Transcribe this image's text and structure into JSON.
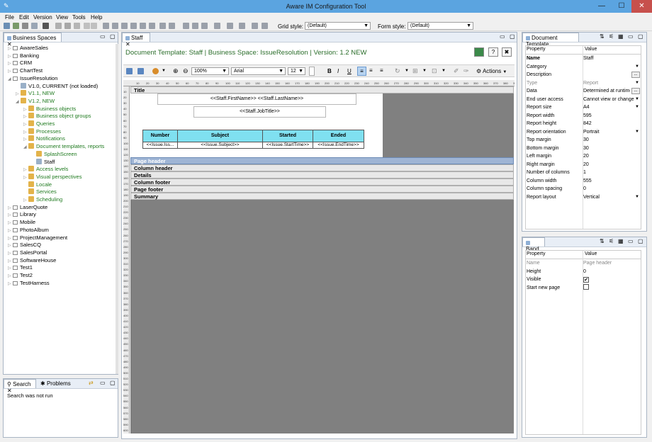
{
  "window": {
    "title": "Aware IM Configuration Tool",
    "min": "—",
    "max": "☐",
    "close": "✕"
  },
  "menu": [
    "File",
    "Edit",
    "Version",
    "View",
    "Tools",
    "Help"
  ],
  "toolbar": {
    "grid_style_label": "Grid style:",
    "grid_style_value": "(Default)",
    "form_style_label": "Form style:",
    "form_style_value": "(Default)"
  },
  "left_panel": {
    "tab": "Business Spaces",
    "tree": [
      {
        "label": "AwareSales",
        "indent": 0,
        "expand": "▷",
        "green": false
      },
      {
        "label": "Banking",
        "indent": 0,
        "expand": "▷",
        "green": false
      },
      {
        "label": "CRM",
        "indent": 0,
        "expand": "▷",
        "green": false
      },
      {
        "label": "ChartTest",
        "indent": 0,
        "expand": "▷",
        "green": false
      },
      {
        "label": "IssueResolution",
        "indent": 0,
        "expand": "◢",
        "green": false
      },
      {
        "label": "V1.0, CURRENT (not loaded)",
        "indent": 1,
        "expand": "",
        "green": false
      },
      {
        "label": "V1.1, NEW",
        "indent": 1,
        "expand": "▷",
        "green": true
      },
      {
        "label": "V1.2, NEW",
        "indent": 1,
        "expand": "◢",
        "green": true
      },
      {
        "label": "Business objects",
        "indent": 2,
        "expand": "▷",
        "green": true
      },
      {
        "label": "Business object groups",
        "indent": 2,
        "expand": "▷",
        "green": true
      },
      {
        "label": "Queries",
        "indent": 2,
        "expand": "▷",
        "green": true
      },
      {
        "label": "Processes",
        "indent": 2,
        "expand": "▷",
        "green": true
      },
      {
        "label": "Notifications",
        "indent": 2,
        "expand": "▷",
        "green": true
      },
      {
        "label": "Document templates, reports",
        "indent": 2,
        "expand": "◢",
        "green": true
      },
      {
        "label": "SplashScreen",
        "indent": 3,
        "expand": "",
        "green": true
      },
      {
        "label": "Staff",
        "indent": 3,
        "expand": "",
        "green": false
      },
      {
        "label": "Access levels",
        "indent": 2,
        "expand": "▷",
        "green": true
      },
      {
        "label": "Visual perspectives",
        "indent": 2,
        "expand": "▷",
        "green": true
      },
      {
        "label": "Locale",
        "indent": 2,
        "expand": "",
        "green": true
      },
      {
        "label": "Services",
        "indent": 2,
        "expand": "",
        "green": true
      },
      {
        "label": "Scheduling",
        "indent": 2,
        "expand": "▷",
        "green": true
      },
      {
        "label": "LaserQuote",
        "indent": 0,
        "expand": "▷",
        "green": false
      },
      {
        "label": "Library",
        "indent": 0,
        "expand": "▷",
        "green": false
      },
      {
        "label": "Mobile",
        "indent": 0,
        "expand": "▷",
        "green": false
      },
      {
        "label": "PhotoAlbum",
        "indent": 0,
        "expand": "▷",
        "green": false
      },
      {
        "label": "ProjectManagement",
        "indent": 0,
        "expand": "▷",
        "green": false
      },
      {
        "label": "SalesCQ",
        "indent": 0,
        "expand": "▷",
        "green": false
      },
      {
        "label": "SalesPortal",
        "indent": 0,
        "expand": "▷",
        "green": false
      },
      {
        "label": "SoftwareHouse",
        "indent": 0,
        "expand": "▷",
        "green": false
      },
      {
        "label": "Test1",
        "indent": 0,
        "expand": "▷",
        "green": false
      },
      {
        "label": "Test2",
        "indent": 0,
        "expand": "▷",
        "green": false
      },
      {
        "label": "TestHarness",
        "indent": 0,
        "expand": "▷",
        "green": false
      }
    ]
  },
  "bottom_left": {
    "tab_search": "Search",
    "tab_problems": "Problems",
    "status": "Search was not run"
  },
  "editor": {
    "tab": "Staff",
    "header": "Document Template: Staff   |   Business Space: IssueResolution   |   Version: 1.2 NEW",
    "zoom": "100%",
    "font": "Arial",
    "font_size": "12",
    "actions": "Actions",
    "title_band": "Title",
    "field_name": "<<Staff.FirstName>> <<Staff.LastName>>",
    "field_job": "<<Staff.JobTitle>>",
    "table_headers": [
      "Number",
      "Subject",
      "Started",
      "Ended"
    ],
    "table_cells": [
      "<<Issue.Iss...",
      "<<Issue.Subject>>",
      "<<Issue.StartTime>>",
      "<<Issue.EndTime>>"
    ],
    "bands": [
      "Page header",
      "Column header",
      "Details",
      "Column footer",
      "Page footer",
      "Summary"
    ],
    "ruler_numbers": [
      "10",
      "20",
      "30",
      "40",
      "50",
      "60",
      "70",
      "80",
      "90",
      "100",
      "110",
      "120",
      "130",
      "140",
      "150",
      "160",
      "170",
      "180",
      "190",
      "200",
      "210",
      "220",
      "230",
      "240",
      "250",
      "260",
      "270",
      "280",
      "290",
      "300",
      "310",
      "320",
      "330",
      "340",
      "350",
      "360",
      "370",
      "380",
      "390",
      "400",
      "410",
      "420",
      "430",
      "440",
      "450",
      "460",
      "470",
      "480",
      "490",
      "500",
      "510",
      "520",
      "530",
      "540",
      "550",
      "560",
      "570",
      "580",
      "590",
      "600"
    ]
  },
  "doc_template_panel": {
    "tab": "Document Template",
    "col_property": "Property",
    "col_value": "Value",
    "rows": [
      {
        "k": "Name",
        "v": "Staff",
        "bold": true,
        "dd": false,
        "dots": false,
        "gray": false
      },
      {
        "k": "Category",
        "v": "",
        "bold": false,
        "dd": true,
        "dots": false,
        "gray": false
      },
      {
        "k": "Description",
        "v": "",
        "bold": false,
        "dd": false,
        "dots": true,
        "gray": false
      },
      {
        "k": "Type",
        "v": "Report",
        "bold": false,
        "dd": true,
        "dots": false,
        "gray": true
      },
      {
        "k": "Data",
        "v": "Determined at runtime",
        "bold": false,
        "dd": false,
        "dots": true,
        "gray": false
      },
      {
        "k": "End user access",
        "v": "Cannot view or change",
        "bold": false,
        "dd": true,
        "dots": false,
        "gray": false
      },
      {
        "k": "Report size",
        "v": "A4",
        "bold": false,
        "dd": true,
        "dots": false,
        "gray": false
      },
      {
        "k": "Report width",
        "v": "595",
        "bold": false,
        "dd": false,
        "dots": false,
        "gray": false
      },
      {
        "k": "Report height",
        "v": "842",
        "bold": false,
        "dd": false,
        "dots": false,
        "gray": false
      },
      {
        "k": "Report orientation",
        "v": "Portrait",
        "bold": false,
        "dd": true,
        "dots": false,
        "gray": false
      },
      {
        "k": "Top margin",
        "v": "30",
        "bold": false,
        "dd": false,
        "dots": false,
        "gray": false
      },
      {
        "k": "Bottom margin",
        "v": "30",
        "bold": false,
        "dd": false,
        "dots": false,
        "gray": false
      },
      {
        "k": "Left margin",
        "v": "20",
        "bold": false,
        "dd": false,
        "dots": false,
        "gray": false
      },
      {
        "k": "Right margin",
        "v": "20",
        "bold": false,
        "dd": false,
        "dots": false,
        "gray": false
      },
      {
        "k": "Number of columns",
        "v": "1",
        "bold": false,
        "dd": false,
        "dots": false,
        "gray": false
      },
      {
        "k": "Column width",
        "v": "555",
        "bold": false,
        "dd": false,
        "dots": false,
        "gray": false
      },
      {
        "k": "Column spacing",
        "v": "0",
        "bold": false,
        "dd": false,
        "dots": false,
        "gray": false
      },
      {
        "k": "Report layout",
        "v": "Vertical",
        "bold": false,
        "dd": true,
        "dots": false,
        "gray": false
      }
    ]
  },
  "band_panel": {
    "tab": "Band",
    "col_property": "Property",
    "col_value": "Value",
    "rows": [
      {
        "k": "Name",
        "v": "Page header",
        "gray": true,
        "check": null
      },
      {
        "k": "Height",
        "v": "0",
        "gray": false,
        "check": null
      },
      {
        "k": "Visible",
        "v": "",
        "gray": false,
        "check": "✔"
      },
      {
        "k": "Start new page",
        "v": "",
        "gray": false,
        "check": ""
      }
    ]
  }
}
